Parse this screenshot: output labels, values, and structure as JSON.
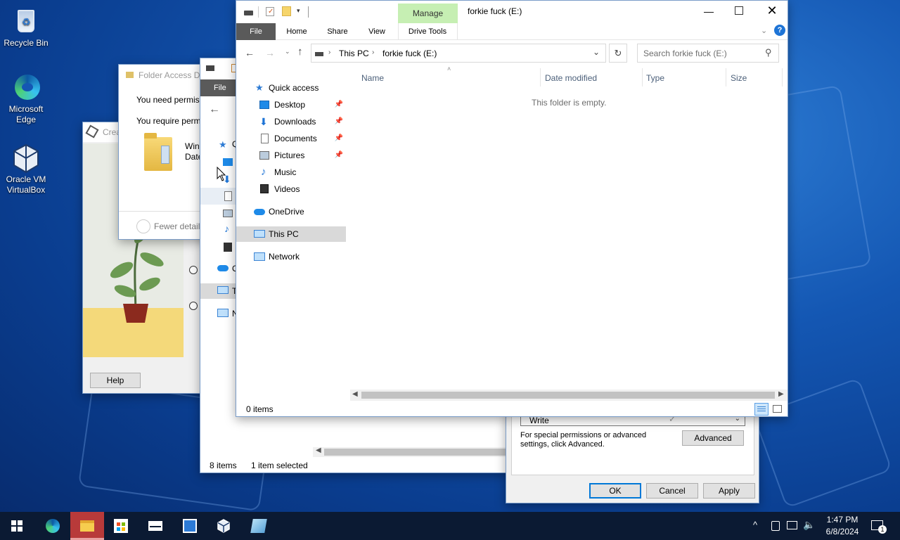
{
  "desktop": {
    "icons": [
      {
        "label": "Recycle Bin"
      },
      {
        "label": "Microsoft Edge"
      },
      {
        "label": "Oracle VM VirtualBox"
      }
    ]
  },
  "vbox_window": {
    "title": "Crea",
    "help_label": "Help"
  },
  "folder_access_dialog": {
    "title": "Folder Access De",
    "line1": "You need permis",
    "line2": "You require perm",
    "item_name": "Win",
    "item_date": "Date",
    "fewer_details": "Fewer details"
  },
  "back_explorer": {
    "file_tab": "File",
    "nav_letters": [
      "Q",
      "O",
      "T",
      "N"
    ],
    "status_items": "8 items",
    "status_selected": "1 item selected"
  },
  "permissions_dialog": {
    "write_value": "Write",
    "special_text": "For special permissions or advanced settings, click Advanced.",
    "advanced_label": "Advanced",
    "ok_label": "OK",
    "cancel_label": "Cancel",
    "apply_label": "Apply"
  },
  "explorer": {
    "title": "forkie fuck (E:)",
    "manage_tab": "Manage",
    "tabs": {
      "file": "File",
      "home": "Home",
      "share": "Share",
      "view": "View",
      "drive_tools": "Drive Tools"
    },
    "breadcrumb": {
      "root": "This PC",
      "current": "forkie fuck (E:)"
    },
    "search_placeholder": "Search forkie fuck (E:)",
    "columns": {
      "name": "Name",
      "date_modified": "Date modified",
      "type": "Type",
      "size": "Size"
    },
    "empty_message": "This folder is empty.",
    "nav": {
      "quick_access": "Quick access",
      "desktop": "Desktop",
      "downloads": "Downloads",
      "documents": "Documents",
      "pictures": "Pictures",
      "music": "Music",
      "videos": "Videos",
      "onedrive": "OneDrive",
      "this_pc": "This PC",
      "network": "Network"
    },
    "status": "0 items"
  },
  "taskbar": {
    "time": "1:47 PM",
    "date": "6/8/2024",
    "notification_count": "1"
  },
  "colors": {
    "accent": "#0078d7",
    "manage_tab": "#c6efb3",
    "file_tab": "#5a5a5a",
    "taskbar": "#0b1a33",
    "active_app": "#b83a3a"
  }
}
